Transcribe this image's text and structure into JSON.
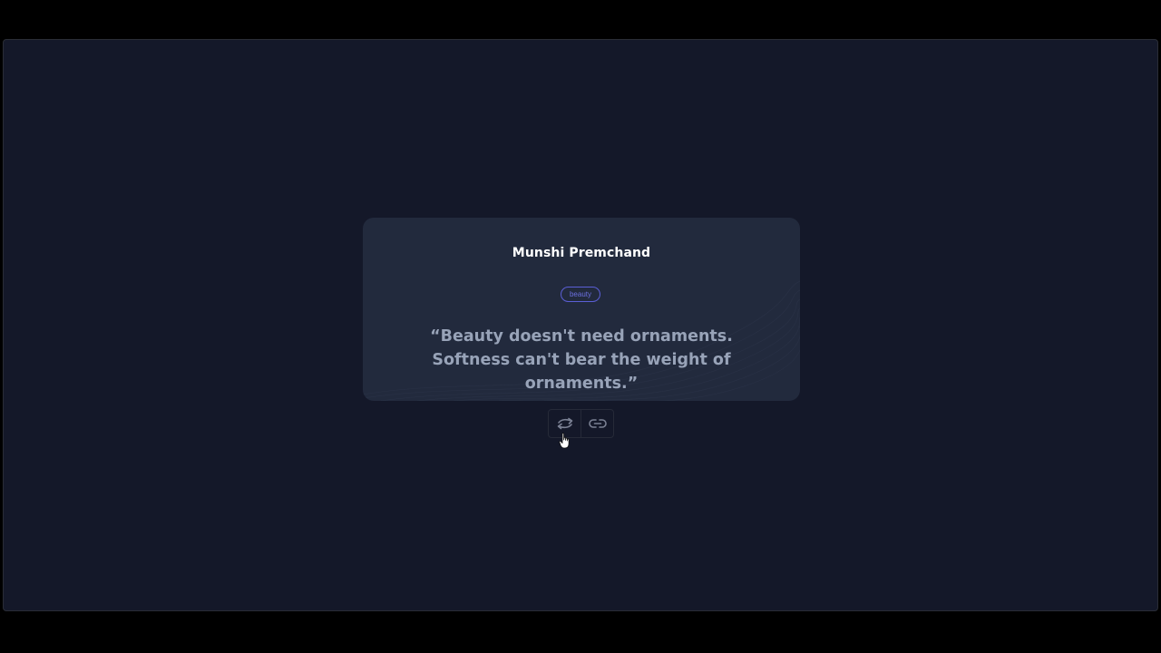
{
  "quote": {
    "author": "Munshi Premchand",
    "tag": "beauty",
    "text": "“Beauty doesn't need ornaments. Softness can't bear the weight of ornaments.”"
  },
  "actions": {
    "new_quote_icon": "arrows-swap-icon",
    "copy_link_icon": "link-icon"
  },
  "colors": {
    "page_bg": "#141829",
    "card_bg": "#222a3d",
    "tag_accent": "#5b5fd6",
    "quote_text": "#98a3b8"
  }
}
